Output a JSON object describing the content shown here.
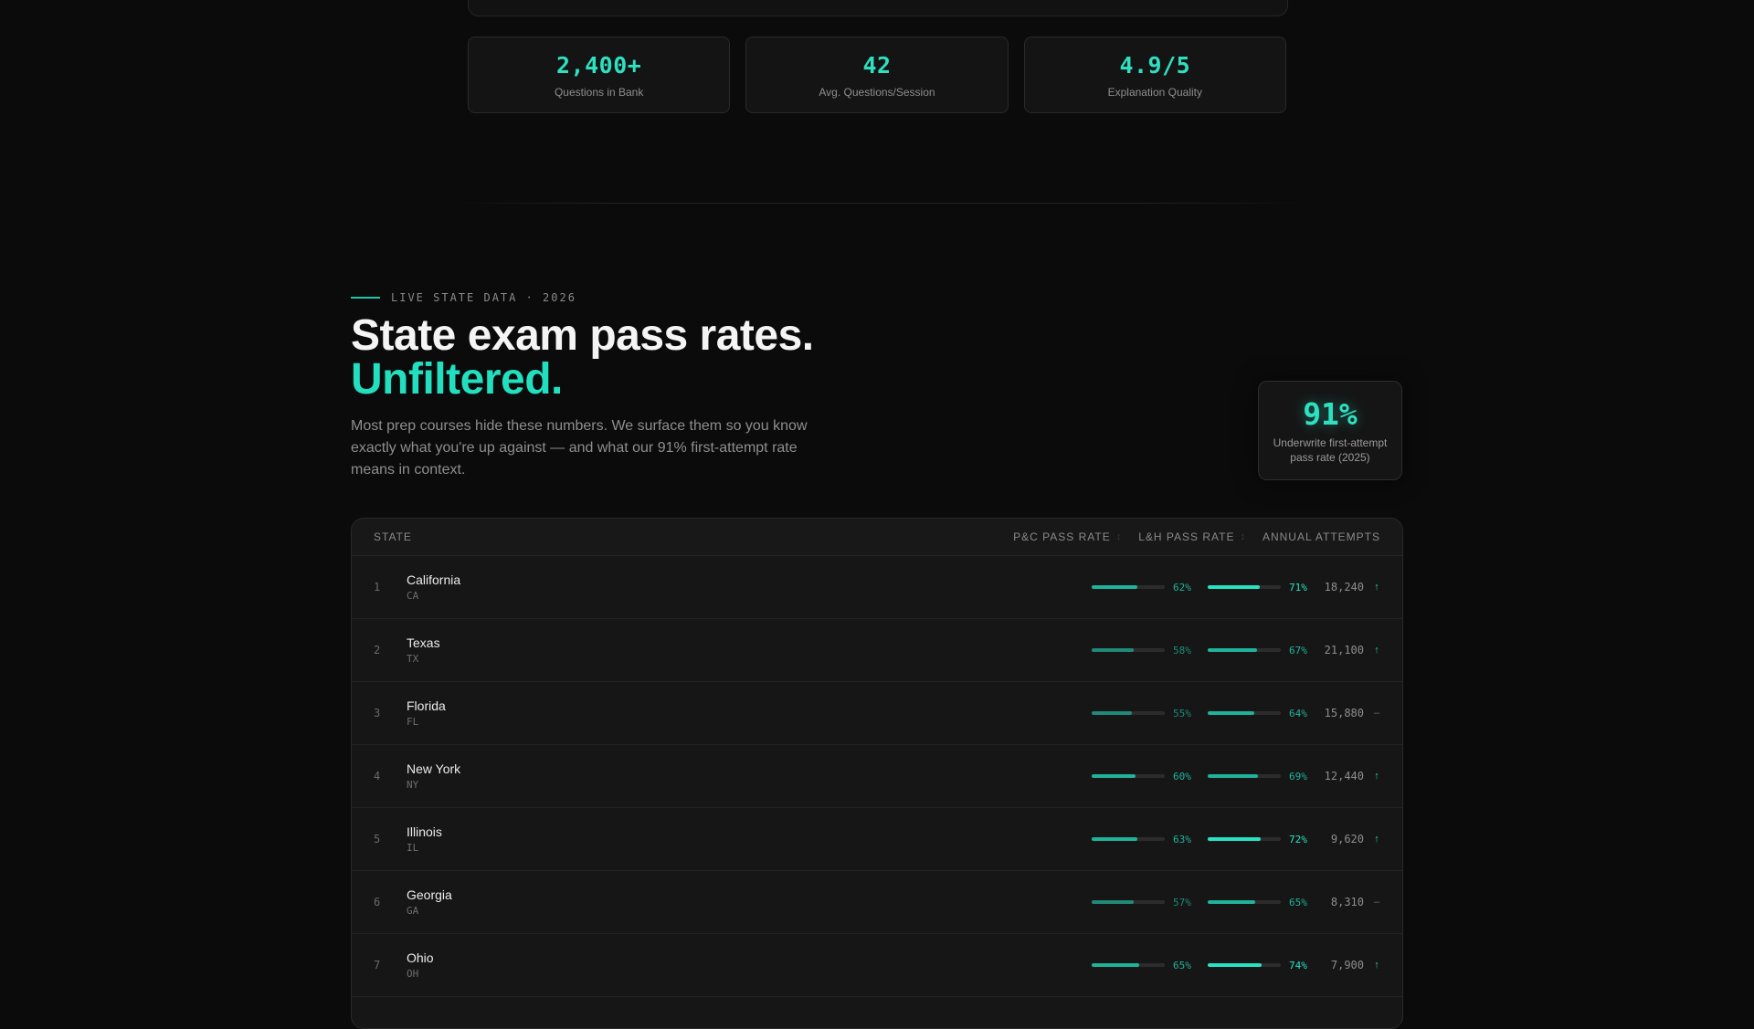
{
  "stats": [
    {
      "value": "2,400+",
      "label": "Questions in Bank"
    },
    {
      "value": "42",
      "label": "Avg. Questions/Session"
    },
    {
      "value": "4.9/5",
      "label": "Explanation Quality"
    }
  ],
  "section": {
    "eyebrow": "LIVE STATE DATA · 2026",
    "title_line1": "State exam pass rates.",
    "title_line2": "Unfiltered.",
    "intro": "Most prep courses hide these numbers. We surface them so you know exactly what you're up against — and what our 91% first-attempt rate means in context."
  },
  "badge": {
    "value": "91%",
    "label": "Underwrite first-attempt pass rate (2025)"
  },
  "table": {
    "headers": {
      "state": "STATE",
      "pc": "P&C PASS RATE",
      "lh": "L&H PASS RATE",
      "attempts": "ANNUAL ATTEMPTS",
      "sort_glyph": "↕"
    },
    "rows": [
      {
        "rank": "1",
        "name": "California",
        "code": "CA",
        "pc": 62,
        "pc_label": "62%",
        "lh": 71,
        "lh_label": "71%",
        "attempts": "18,240",
        "trend": "↑"
      },
      {
        "rank": "2",
        "name": "Texas",
        "code": "TX",
        "pc": 58,
        "pc_label": "58%",
        "lh": 67,
        "lh_label": "67%",
        "attempts": "21,100",
        "trend": "↑"
      },
      {
        "rank": "3",
        "name": "Florida",
        "code": "FL",
        "pc": 55,
        "pc_label": "55%",
        "lh": 64,
        "lh_label": "64%",
        "attempts": "15,880",
        "trend": "–"
      },
      {
        "rank": "4",
        "name": "New York",
        "code": "NY",
        "pc": 60,
        "pc_label": "60%",
        "lh": 69,
        "lh_label": "69%",
        "attempts": "12,440",
        "trend": "↑"
      },
      {
        "rank": "5",
        "name": "Illinois",
        "code": "IL",
        "pc": 63,
        "pc_label": "63%",
        "lh": 72,
        "lh_label": "72%",
        "attempts": "9,620",
        "trend": "↑"
      },
      {
        "rank": "6",
        "name": "Georgia",
        "code": "GA",
        "pc": 57,
        "pc_label": "57%",
        "lh": 65,
        "lh_label": "65%",
        "attempts": "8,310",
        "trend": "–"
      },
      {
        "rank": "7",
        "name": "Ohio",
        "code": "OH",
        "pc": 65,
        "pc_label": "65%",
        "lh": 74,
        "lh_label": "74%",
        "attempts": "7,900",
        "trend": "↑"
      }
    ]
  },
  "colors": {
    "accent": "#22e0bf",
    "bar_dim": "#1f8a78",
    "bar_mid": "#1fb39a",
    "bar_bright": "#26e3c2",
    "trend_up": "#22c9a8",
    "trend_flat": "#6e6e6e"
  }
}
